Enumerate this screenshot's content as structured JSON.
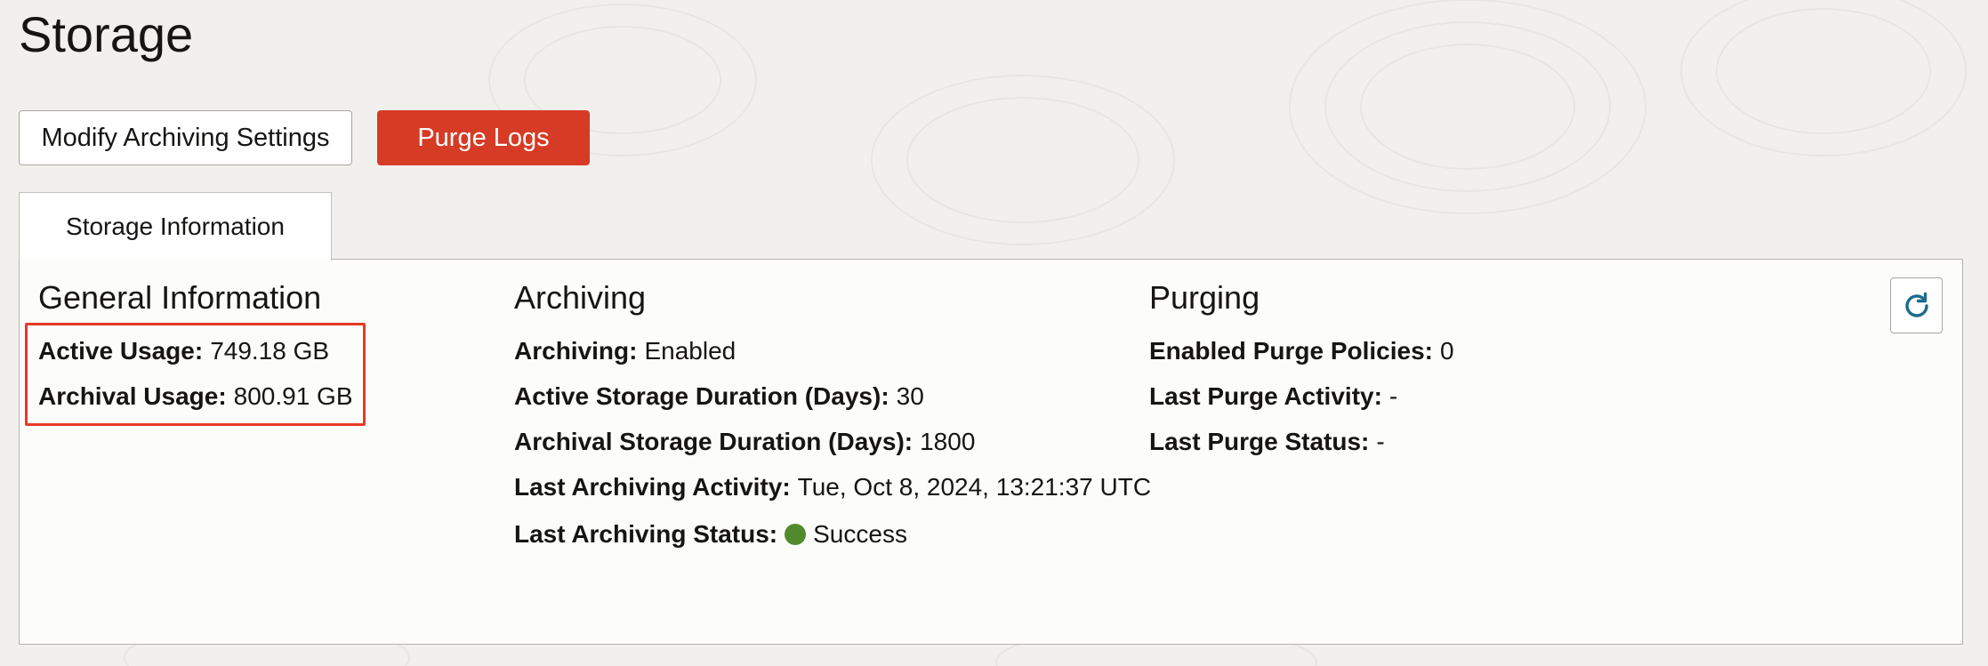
{
  "page": {
    "title": "Storage"
  },
  "toolbar": {
    "modify_label": "Modify Archiving Settings",
    "purge_label": "Purge Logs"
  },
  "tabs": [
    {
      "label": "Storage Information",
      "selected": true
    }
  ],
  "general": {
    "title": "General Information",
    "rows": [
      {
        "label": "Active Usage:",
        "value": "749.18 GB"
      },
      {
        "label": "Archival Usage:",
        "value": "800.91 GB"
      }
    ]
  },
  "archiving": {
    "title": "Archiving",
    "rows": [
      {
        "label": "Archiving:",
        "value": "Enabled"
      },
      {
        "label": "Active Storage Duration (Days):",
        "value": "30"
      },
      {
        "label": "Archival Storage Duration (Days):",
        "value": "1800"
      },
      {
        "label": "Last Archiving Activity:",
        "value": "Tue, Oct 8, 2024, 13:21:37 UTC"
      },
      {
        "label": "Last Archiving Status:",
        "value": "Success"
      }
    ]
  },
  "purging": {
    "title": "Purging",
    "rows": [
      {
        "label": "Enabled Purge Policies:",
        "value": "0"
      },
      {
        "label": "Last Purge Activity:",
        "value": "-"
      },
      {
        "label": "Last Purge Status:",
        "value": "-"
      }
    ]
  },
  "icons": {
    "refresh": "refresh-icon",
    "status": "success-status-dot"
  },
  "colors": {
    "accent_red": "#d63b25",
    "highlight_red": "#e53a26",
    "success_green": "#508a2d",
    "refresh_blue": "#1c6b8c"
  }
}
